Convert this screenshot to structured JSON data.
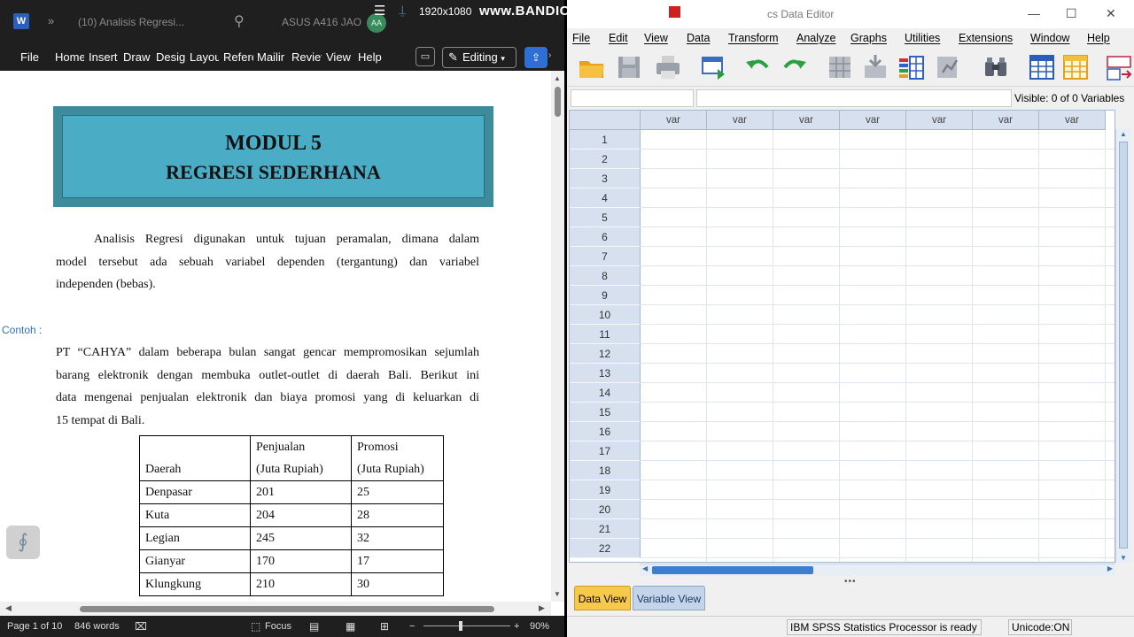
{
  "word": {
    "title_doc": "(10) Analisis Regresi...",
    "account": "ASUS A416 JAO",
    "avatar": "AA",
    "ribbon_tabs": [
      "File",
      "Home",
      "Insert",
      "Draw",
      "Desig",
      "Layou",
      "Refere",
      "Mailir",
      "Reviev",
      "View",
      "Help"
    ],
    "editing_label": "Editing",
    "banner_line1": "MODUL 5",
    "banner_line2": "REGRESI SEDERHANA",
    "para1": [
      "Analisis Regresi digunakan untuk tujuan peramalan, dimana dalam",
      "model tersebut ada sebuah variabel dependen (tergantung) dan variabel",
      "independen (bebas)."
    ],
    "contoh_label": "Contoh :",
    "para2": [
      "PT “CAHYA” dalam beberapa bulan sangat gencar mempromosikan sejumlah",
      "barang elektronik dengan membuka outlet-outlet di daerah Bali. Berikut ini",
      "data mengenai penjualan elektronik dan biaya promosi yang di keluarkan di",
      "15 tempat di Bali."
    ],
    "table": {
      "headers": [
        [
          "",
          "Daerah"
        ],
        [
          "Penjualan",
          "(Juta Rupiah)"
        ],
        [
          "Promosi",
          "(Juta Rupiah)"
        ]
      ],
      "rows": [
        [
          "Denpasar",
          "201",
          "25"
        ],
        [
          "Kuta",
          "204",
          "28"
        ],
        [
          "Legian",
          "245",
          "32"
        ],
        [
          "Gianyar",
          "170",
          "17"
        ],
        [
          "Klungkung",
          "210",
          "30"
        ]
      ]
    },
    "status": {
      "page": "Page 1 of 10",
      "words": "846 words",
      "focus": "Focus",
      "zoom": "90%"
    }
  },
  "bandicam": {
    "resolution": "1920x1080",
    "brand": "www.BANDICAM.com"
  },
  "spss": {
    "title": "cs Data Editor",
    "menu": [
      "File",
      "Edit",
      "View",
      "Data",
      "Transform",
      "Analyze",
      "Graphs",
      "Utilities",
      "Extensions",
      "Window",
      "Help"
    ],
    "toolbar_icons": [
      "open-folder-icon",
      "save-icon",
      "print-icon",
      "dialog-recall-icon",
      "undo-icon",
      "redo-icon",
      "goto-case-icon",
      "goto-variable-icon",
      "variables-icon",
      "run-descriptives-icon",
      "find-icon",
      "insert-cases-icon",
      "insert-variable-icon",
      "value-labels-icon"
    ],
    "visible_label": "Visible: 0 of 0 Variables",
    "column_header": "var",
    "column_count": 7,
    "row_numbers": [
      "1",
      "2",
      "3",
      "4",
      "5",
      "6",
      "7",
      "8",
      "9",
      "10",
      "11",
      "12",
      "13",
      "14",
      "15",
      "16",
      "17",
      "18",
      "19",
      "20",
      "21",
      "22"
    ],
    "tabs": [
      "Data View",
      "Variable View"
    ],
    "status": {
      "processor": "IBM SPSS Statistics Processor is ready",
      "unicode": "Unicode:ON"
    },
    "colors": {
      "data_view_tab": "#f7c94a",
      "header_fill": "#d6e0ee",
      "scroll_thumb": "#3c7fd0"
    }
  }
}
